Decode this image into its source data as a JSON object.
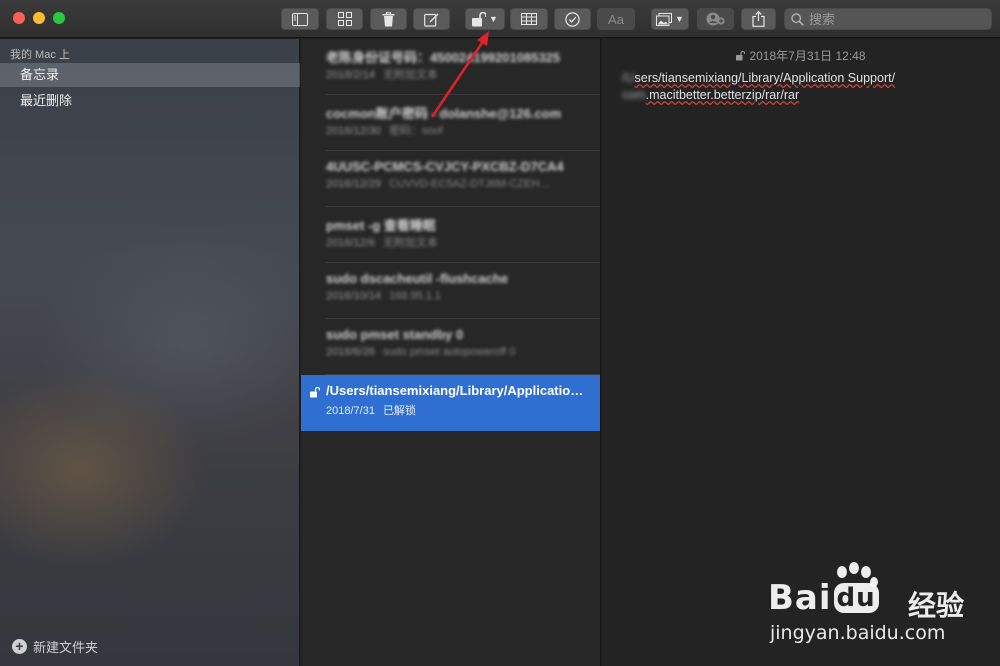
{
  "toolbar": {
    "search_placeholder": "搜索",
    "font_label": "Aa"
  },
  "sidebar": {
    "section": "我的 Mac 上",
    "items": [
      {
        "label": "备忘录",
        "selected": true
      },
      {
        "label": "最近删除",
        "selected": false
      }
    ],
    "new_folder": "新建文件夹"
  },
  "notes": [
    {
      "title": "老陈身份证号码：450024199201085325",
      "date": "2018/2/14",
      "preview": "无附加文本",
      "blurred": true
    },
    {
      "title": "cocmon账户密码 - dolanshe@126.com",
      "date": "2016/12/30",
      "preview": "密码：soof",
      "blurred": true
    },
    {
      "title": "4UUSC-PCMCS-CVJCY-PXCBZ-D7CA4",
      "date": "2016/12/29",
      "preview": "CUVVD-EC5AZ-DTJ6M-CZEH…",
      "blurred": true
    },
    {
      "title": "pmset -g 查看睡眠",
      "date": "2016/12/6",
      "preview": "无附加文本",
      "blurred": true
    },
    {
      "title": "sudo dscacheutil -flushcache",
      "date": "2016/10/14",
      "preview": "168.95.1.1",
      "blurred": true
    },
    {
      "title": "sudo pmset standby 0",
      "date": "2016/6/26",
      "preview": "sudo pmset autopoweroff 0",
      "blurred": true
    },
    {
      "title": "/Users/tiansemixiang/Library/Application Support/",
      "date": "2018/7/31",
      "preview": "已解锁",
      "blurred": false,
      "selected": true,
      "locked_icon": "unlocked-icon"
    }
  ],
  "editor": {
    "date": "2018年7月31日 12:48",
    "line1_prefix": "/U",
    "line1": "sers/tiansemixiang/Library/Application Support/",
    "line2_prefix": "com",
    "line2": ".macitbetter.betterzip/rar/rar"
  },
  "watermark": {
    "brand": "Bai",
    "brand2": "du",
    "cn": "经验",
    "url": "jingyan.baidu.com"
  },
  "colors": {
    "accent_selected": "#2e6fd1",
    "annotation_arrow": "#e0202a"
  }
}
